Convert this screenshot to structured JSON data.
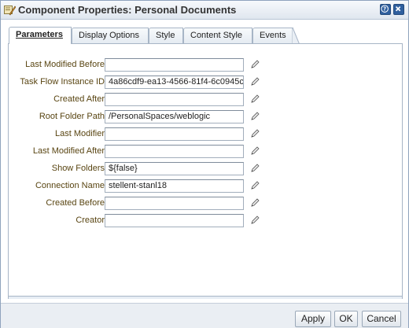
{
  "window": {
    "title": "Component Properties: Personal Documents"
  },
  "tabs": [
    {
      "label": "Parameters",
      "active": true
    },
    {
      "label": "Display Options",
      "active": false
    },
    {
      "label": "Style",
      "active": false
    },
    {
      "label": "Content Style",
      "active": false
    },
    {
      "label": "Events",
      "active": false
    }
  ],
  "parameters": [
    {
      "label": "Last Modified Before",
      "value": ""
    },
    {
      "label": "Task Flow Instance ID",
      "value": "4a86cdf9-ea13-4566-81f4-6c0945c"
    },
    {
      "label": "Created After",
      "value": ""
    },
    {
      "label": "Root Folder Path",
      "value": "/PersonalSpaces/weblogic"
    },
    {
      "label": "Last Modifier",
      "value": ""
    },
    {
      "label": "Last Modified After",
      "value": ""
    },
    {
      "label": "Show Folders",
      "value": "${false}"
    },
    {
      "label": "Connection Name",
      "value": "stellent-stanl18"
    },
    {
      "label": "Created Before",
      "value": ""
    },
    {
      "label": "Creator",
      "value": ""
    }
  ],
  "buttons": {
    "apply": "Apply",
    "ok": "OK",
    "cancel": "Cancel"
  },
  "colors": {
    "label": "#594512",
    "title_button": "#2f5f9e"
  }
}
